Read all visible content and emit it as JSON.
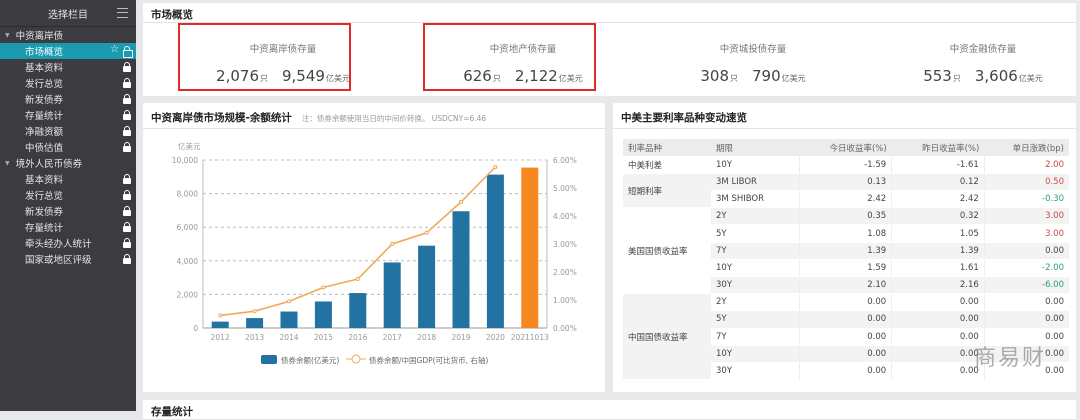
{
  "sidebar": {
    "title": "选择栏目",
    "groups": [
      {
        "label": "中资离岸债",
        "items": [
          "市场概览",
          "基本资料",
          "发行总览",
          "新发债券",
          "存量统计",
          "净融资额",
          "中债估值"
        ]
      },
      {
        "label": "境外人民币债券",
        "items": [
          "基本资料",
          "发行总览",
          "新发债券",
          "存量统计",
          "牵头经办人统计",
          "国家或地区评级"
        ]
      }
    ]
  },
  "overview": {
    "title": "市场概览",
    "stats": [
      {
        "label": "中资离岸债存量",
        "count": "2,076",
        "count_unit": "只",
        "amount": "9,549",
        "amount_unit": "亿美元",
        "highlighted": true
      },
      {
        "label": "中资地产债存量",
        "count": "626",
        "count_unit": "只",
        "amount": "2,122",
        "amount_unit": "亿美元",
        "highlighted": true
      },
      {
        "label": "中资城投债存量",
        "count": "308",
        "count_unit": "只",
        "amount": "790",
        "amount_unit": "亿美元",
        "highlighted": false
      },
      {
        "label": "中资金融债存量",
        "count": "553",
        "count_unit": "只",
        "amount": "3,606",
        "amount_unit": "亿美元",
        "highlighted": false
      }
    ]
  },
  "chart_panel": {
    "title": "中资离岸债市场规模-余额统计",
    "note": "注：债券余额使用当日的中间价转换。 USDCNY=6.46"
  },
  "chart_data": {
    "type": "bar+line",
    "ylabel": "亿美元",
    "categories": [
      "2012",
      "2013",
      "2014",
      "2015",
      "2016",
      "2017",
      "2018",
      "2019",
      "2020",
      "20211013"
    ],
    "series": [
      {
        "name": "债券余额(亿美元)",
        "type": "bar",
        "axis": "left",
        "values": [
          380,
          590,
          980,
          1580,
          2080,
          3900,
          4900,
          6950,
          9130,
          9549
        ],
        "color": "#2272a2",
        "highlight_last_color": "#f5881f"
      },
      {
        "name": "债券余额/中国GDP(可比货币, 右轴)",
        "type": "line",
        "axis": "right",
        "values": [
          0.45,
          0.6,
          0.95,
          1.45,
          1.75,
          3.0,
          3.4,
          4.5,
          5.75,
          null
        ],
        "color": "#f0a95a"
      }
    ],
    "ylim": [
      0,
      10000
    ],
    "yticks": [
      "0",
      "2,000",
      "4,000",
      "6,000",
      "8,000",
      "10,000"
    ],
    "y2lim": [
      0,
      6
    ],
    "y2ticks": [
      "0.00%",
      "1.00%",
      "2.00%",
      "3.00%",
      "4.00%",
      "5.00%",
      "6.00%"
    ],
    "legend": "bottom",
    "grid": true
  },
  "rates": {
    "title": "中美主要利率品种变动速览",
    "headers": [
      "利率品种",
      "期限",
      "今日收益率(%)",
      "昨日收益率(%)",
      "单日涨跌(bp)"
    ],
    "groups": [
      {
        "name": "中美利差",
        "rows": [
          [
            "10Y",
            "-1.59",
            "-1.61",
            "2.00"
          ]
        ]
      },
      {
        "name": "短期利率",
        "rows": [
          [
            "3M LIBOR",
            "0.13",
            "0.12",
            "0.50"
          ],
          [
            "3M SHIBOR",
            "2.42",
            "2.42",
            "-0.30"
          ]
        ]
      },
      {
        "name": "美国国债收益率",
        "rows": [
          [
            "2Y",
            "0.35",
            "0.32",
            "3.00"
          ],
          [
            "5Y",
            "1.08",
            "1.05",
            "3.00"
          ],
          [
            "7Y",
            "1.39",
            "1.39",
            "0.00"
          ],
          [
            "10Y",
            "1.59",
            "1.61",
            "-2.00"
          ],
          [
            "30Y",
            "2.10",
            "2.16",
            "-6.00"
          ]
        ]
      },
      {
        "name": "中国国债收益率",
        "rows": [
          [
            "2Y",
            "0.00",
            "0.00",
            "0.00"
          ],
          [
            "5Y",
            "0.00",
            "0.00",
            "0.00"
          ],
          [
            "7Y",
            "0.00",
            "0.00",
            "0.00"
          ],
          [
            "10Y",
            "0.00",
            "0.00",
            "0.00"
          ],
          [
            "30Y",
            "0.00",
            "0.00",
            "0.00"
          ]
        ]
      }
    ]
  },
  "watermark": "商易财",
  "bottom_panel": {
    "title": "存量统计"
  }
}
